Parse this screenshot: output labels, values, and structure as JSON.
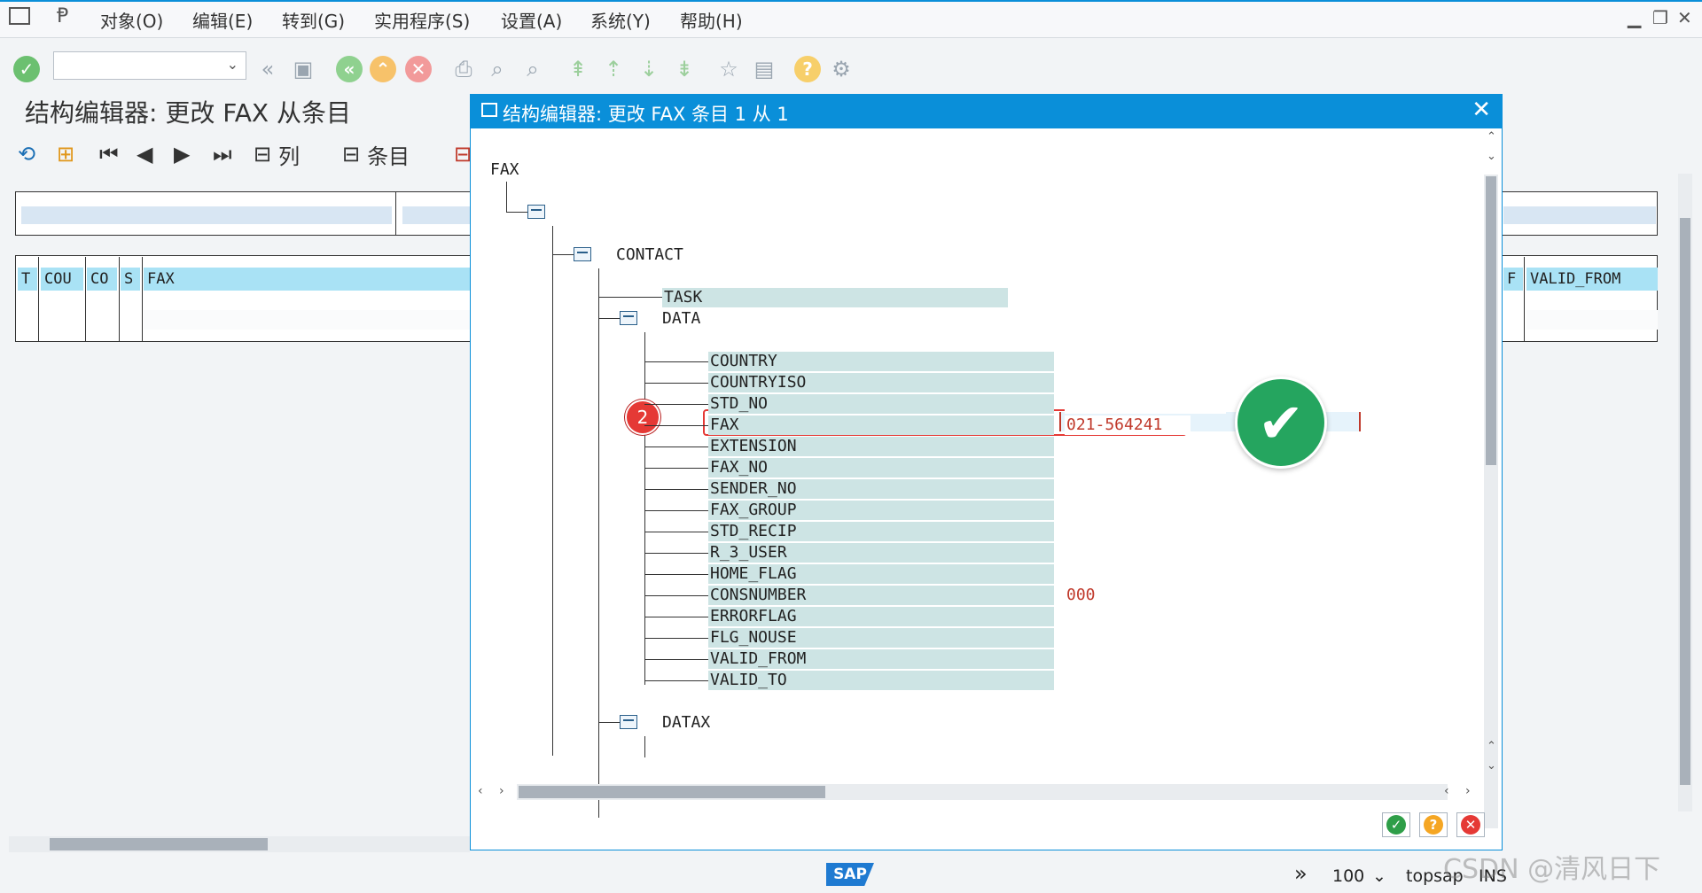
{
  "menubar": {
    "items": [
      "对象(O)",
      "编辑(E)",
      "转到(G)",
      "实用程序(S)",
      "设置(A)",
      "系统(Y)",
      "帮助(H)"
    ],
    "minimize": "▁",
    "restore": "❐",
    "close": "✕"
  },
  "toolbar": {
    "command_value": "",
    "dropdown_arrow": "⌄"
  },
  "page": {
    "title": "结构编辑器: 更改 FAX 从条目"
  },
  "app_toolbar": {
    "col_label": "列",
    "entry_label": "条目"
  },
  "background_table": {
    "headers": [
      "T",
      "COU",
      "CO",
      "S",
      "FAX",
      "F",
      "VALID_FROM"
    ]
  },
  "dialog": {
    "title": "结构编辑器: 更改 FAX 条目 1 从 1",
    "close": "✕",
    "tree": {
      "root": "FAX",
      "contact": "CONTACT",
      "task": "TASK",
      "data": "DATA",
      "datax": "DATAX",
      "fields": [
        {
          "name": "COUNTRY",
          "value": ""
        },
        {
          "name": "COUNTRYISO",
          "value": ""
        },
        {
          "name": "STD_NO",
          "value": ""
        },
        {
          "name": "FAX",
          "value": "021-564241"
        },
        {
          "name": "EXTENSION",
          "value": ""
        },
        {
          "name": "FAX_NO",
          "value": ""
        },
        {
          "name": "SENDER_NO",
          "value": ""
        },
        {
          "name": "FAX_GROUP",
          "value": ""
        },
        {
          "name": "STD_RECIP",
          "value": ""
        },
        {
          "name": "R_3_USER",
          "value": ""
        },
        {
          "name": "HOME_FLAG",
          "value": ""
        },
        {
          "name": "CONSNUMBER",
          "value": "000"
        },
        {
          "name": "ERRORFLAG",
          "value": ""
        },
        {
          "name": "FLG_NOUSE",
          "value": ""
        },
        {
          "name": "VALID_FROM",
          "value": ""
        },
        {
          "name": "VALID_TO",
          "value": ""
        }
      ]
    },
    "step_badge": "2",
    "confirm_mark": "✔"
  },
  "statusbar": {
    "sap_logo": "SAP",
    "expand": "»",
    "client": "100",
    "client_arrow": "⌄",
    "server": "topsap",
    "mode": "INS",
    "watermark": "CSDN @清风日下"
  },
  "colors": {
    "accent": "#0a8fd9",
    "ok_green": "#4caf50",
    "cancel_red": "#e53935",
    "help_orange": "#f5a623",
    "field_bg": "#cde4e4",
    "value_red": "#c0392b",
    "highlight_red": "#e53935"
  }
}
